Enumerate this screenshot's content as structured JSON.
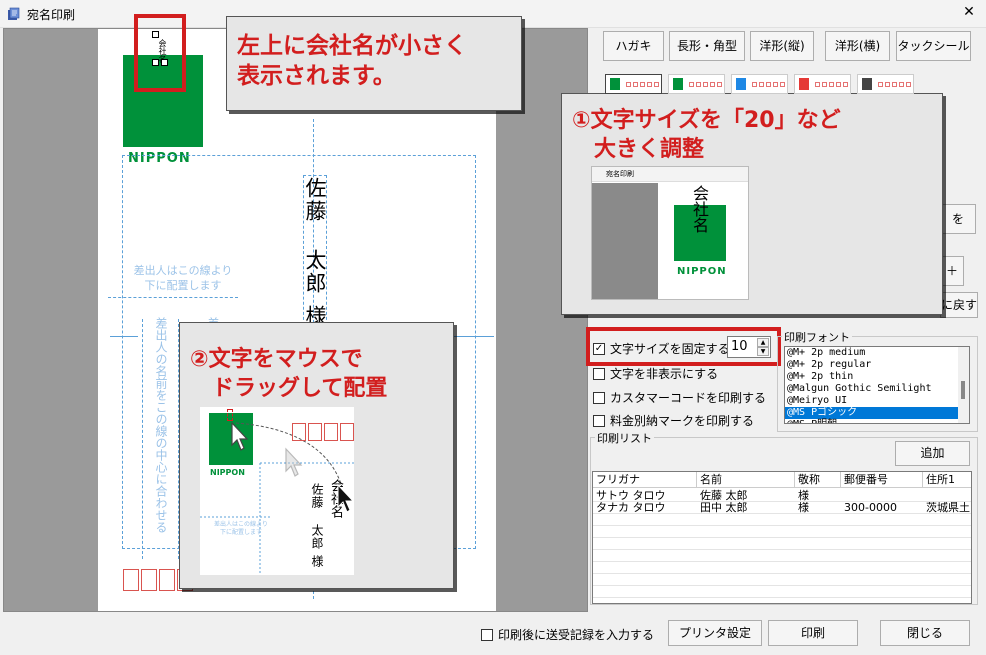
{
  "window": {
    "title": "宛名印刷",
    "close_icon": "close-icon"
  },
  "envelope_buttons": [
    "ハガキ",
    "長形・角型",
    "洋形(縦)",
    "洋形(横)",
    "タックシール"
  ],
  "swatches": [
    "#00913a",
    "#00913a",
    "#1e88e5",
    "#e53935",
    "#444444"
  ],
  "preview": {
    "company_logo_text": "NIPPON",
    "company_small": "会社名",
    "recipient_name": "佐藤 太郎",
    "honorific": "様",
    "sender_note": "差出人はこの線より\n下に配置します",
    "sender_vertical": "差出人の名前をこの線の中心に合わせる",
    "sender_vertical2": "差"
  },
  "callouts": {
    "top_left": "左上に会社名が小さく\n表示されます。",
    "step1": "①文字サイズを「20」など\n　大きく調整",
    "step2": "②文字をマウスで\n　ドラッグして配置"
  },
  "inset1": {
    "title": "宛名印刷",
    "company": "会社名",
    "logo": "NIPPON"
  },
  "inset2": {
    "logo": "NIPPON",
    "company": "会社名",
    "name": "佐藤 太郎",
    "honorific": "様",
    "note": "差出人はこの線より\n下に配置します"
  },
  "options": {
    "fix_font_size_label": "文字サイズを固定する",
    "fix_font_size_checked": true,
    "font_size_value": "10",
    "hide_text_label": "文字を非表示にする",
    "customer_barcode_label": "カスタマーコードを印刷する",
    "postage_mark_label": "料金別納マークを印刷する"
  },
  "partial_buttons": {
    "right_a": "を",
    "right_b": "＋",
    "restore": "に戻す"
  },
  "font_group": {
    "label": "印刷フォント",
    "items": [
      "@M+ 2p medium",
      "@M+ 2p regular",
      "@M+ 2p thin",
      "@Malgun Gothic Semilight",
      "@Meiryo UI",
      "@MS Pゴシック",
      "@MS P明朝"
    ],
    "selected_index": 5
  },
  "print_list": {
    "label": "印刷リスト",
    "add_button": "追加",
    "columns": [
      "フリガナ",
      "名前",
      "敬称",
      "郵便番号",
      "住所1"
    ],
    "rows": [
      [
        "サトウ タロウ",
        "佐藤 太郎",
        "様",
        "",
        ""
      ],
      [
        "タナカ タロウ",
        "田中 太郎",
        "様",
        "300-0000",
        "茨城県土"
      ]
    ]
  },
  "footer": {
    "record_checkbox_label": "印刷後に送受記録を入力する",
    "printer_settings": "プリンタ設定",
    "print": "印刷",
    "close": "閉じる"
  }
}
